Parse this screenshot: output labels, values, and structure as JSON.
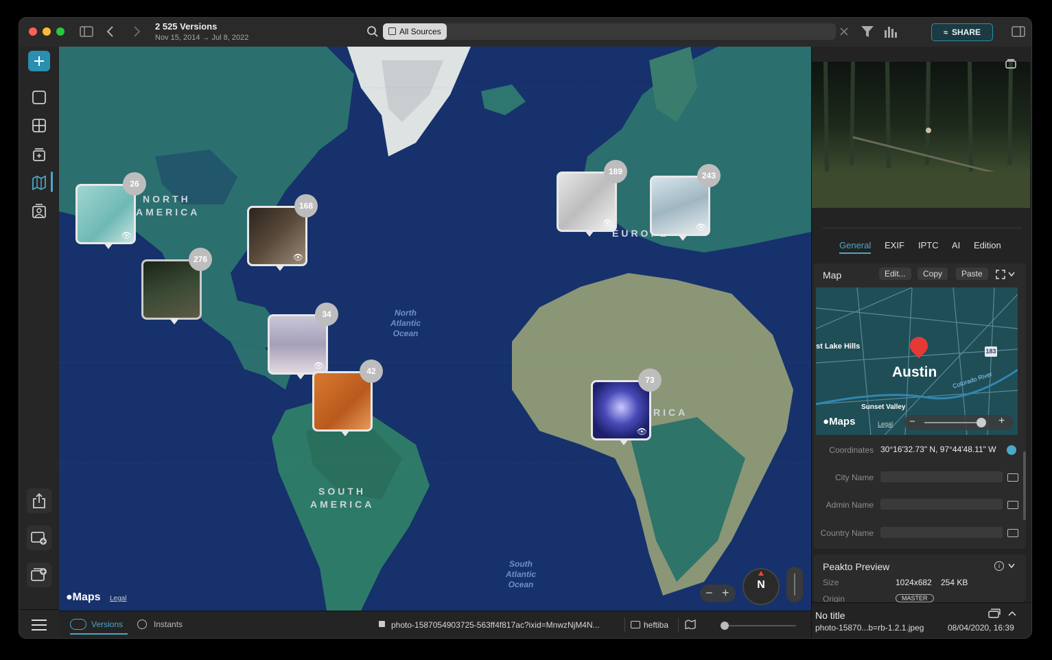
{
  "window": {
    "title": "2 525 Versions",
    "subtitle": "Nov 15, 2014 → Jul 8, 2022"
  },
  "toolbar": {
    "source_chip": "All Sources",
    "share_label": "SHARE"
  },
  "map": {
    "continents": [
      "NORTH",
      "AMERICA",
      "EUROPE",
      "SOUTH",
      "AMERICA",
      "RICA"
    ],
    "ocean_north": [
      "North",
      "Atlantic",
      "Ocean"
    ],
    "ocean_south": [
      "South",
      "Atlantic",
      "Ocean"
    ],
    "maps_brand": "Maps",
    "legal": "Legal",
    "compass": "N",
    "clusters": [
      {
        "count": "26",
        "name": "cluster-26"
      },
      {
        "count": "168",
        "name": "cluster-168"
      },
      {
        "count": "276",
        "name": "cluster-276"
      },
      {
        "count": "34",
        "name": "cluster-34"
      },
      {
        "count": "42",
        "name": "cluster-42"
      },
      {
        "count": "189",
        "name": "cluster-189"
      },
      {
        "count": "243",
        "name": "cluster-243"
      },
      {
        "count": "73",
        "name": "cluster-73"
      }
    ]
  },
  "bottom": {
    "versions_label": "Versions",
    "instants_label": "Instants",
    "file_name": "photo-1587054903725-563ff4f817ac?ixid=MnwzNjM4N...",
    "folder": "heftiba"
  },
  "inspector": {
    "tabs": [
      "General",
      "EXIF",
      "IPTC",
      "AI",
      "Edition"
    ],
    "active_tab": "General",
    "map_section": {
      "title": "Map",
      "edit": "Edit...",
      "copy": "Copy",
      "paste": "Paste",
      "mini_city": "Austin",
      "mini_labels": [
        "st Lake Hills",
        "Sunset Valley",
        "Colorado River"
      ],
      "mini_route": "183",
      "mini_maps": "Maps",
      "mini_legal": "Legal"
    },
    "fields": [
      {
        "label": "Coordinates",
        "value": "30°16'32.73\" N, 97°44'48.11\" W"
      },
      {
        "label": "City Name",
        "value": ""
      },
      {
        "label": "Admin Name",
        "value": ""
      },
      {
        "label": "Country Name",
        "value": ""
      }
    ],
    "preview": {
      "title": "Peakto Preview",
      "size_label": "Size",
      "size_value": "1024x682",
      "file_size": "254 KB",
      "origin_label": "Origin",
      "origin_badge": "MASTER"
    },
    "footer": {
      "title": "No title",
      "file": "photo-15870...b=rb-1.2.1.jpeg",
      "date": "08/04/2020, 16:39"
    }
  }
}
